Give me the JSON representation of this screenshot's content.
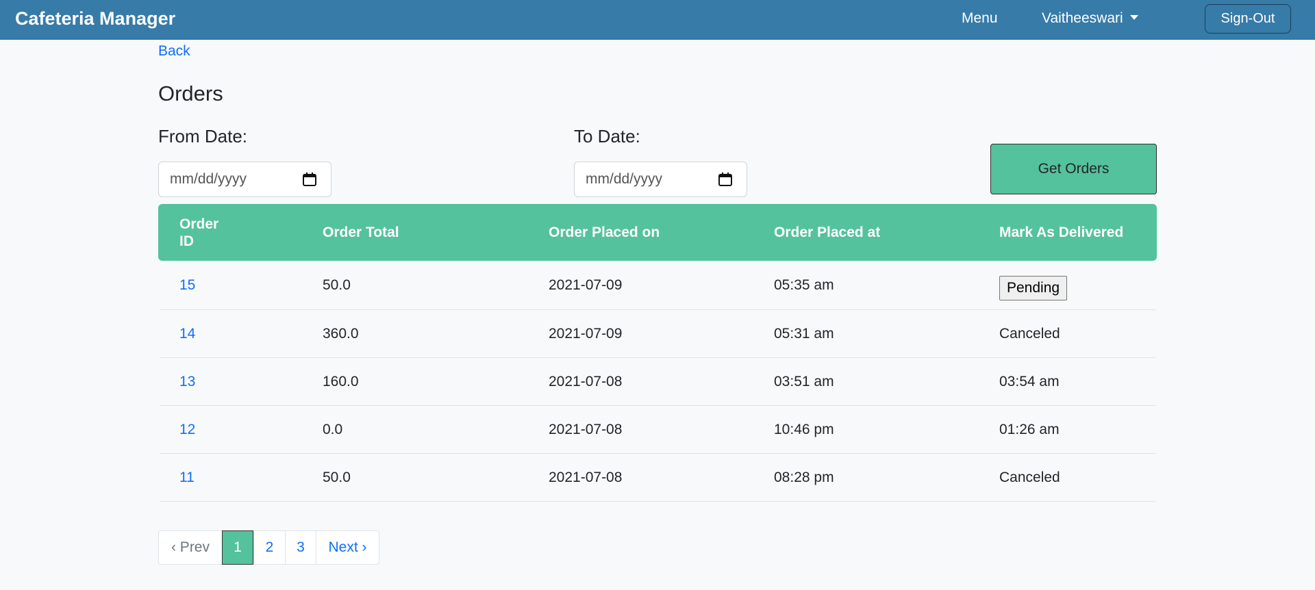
{
  "navbar": {
    "brand": "Cafeteria Manager",
    "menu_label": "Menu",
    "user_label": "Vaitheeswari",
    "signout_label": "Sign-Out"
  },
  "back_label": "Back",
  "page_title": "Orders",
  "filters": {
    "from_label": "From Date:",
    "to_label": "To Date:",
    "from_placeholder": "mm/dd/yyyy",
    "to_placeholder": "mm/dd/yyyy",
    "get_orders_label": "Get Orders"
  },
  "table": {
    "headers": [
      "Order ID",
      "Order Total",
      "Order Placed on",
      "Order Placed at",
      "Mark As Delivered"
    ],
    "header_id_line1": "Order",
    "header_id_line2": "ID",
    "rows": [
      {
        "id": "15",
        "total": "50.0",
        "date": "2021-07-09",
        "time": "05:35 am",
        "status": "Pending"
      },
      {
        "id": "14",
        "total": "360.0",
        "date": "2021-07-09",
        "time": "05:31 am",
        "status": "Canceled"
      },
      {
        "id": "13",
        "total": "160.0",
        "date": "2021-07-08",
        "time": "03:51 am",
        "status": "03:54 am"
      },
      {
        "id": "12",
        "total": "0.0",
        "date": "2021-07-08",
        "time": "10:46 pm",
        "status": "01:26 am"
      },
      {
        "id": "11",
        "total": "50.0",
        "date": "2021-07-08",
        "time": "08:28 pm",
        "status": "Canceled"
      }
    ]
  },
  "pagination": {
    "prev": "‹ Prev",
    "pages": [
      "1",
      "2",
      "3"
    ],
    "current": "1",
    "next": "Next ›"
  },
  "colors": {
    "navbar": "#377ba8",
    "accent_green": "#54c29c",
    "link_blue": "#0d6efd"
  },
  "icons": {
    "date_picker": "calendar-icon",
    "user_dropdown": "caret-down-icon"
  }
}
